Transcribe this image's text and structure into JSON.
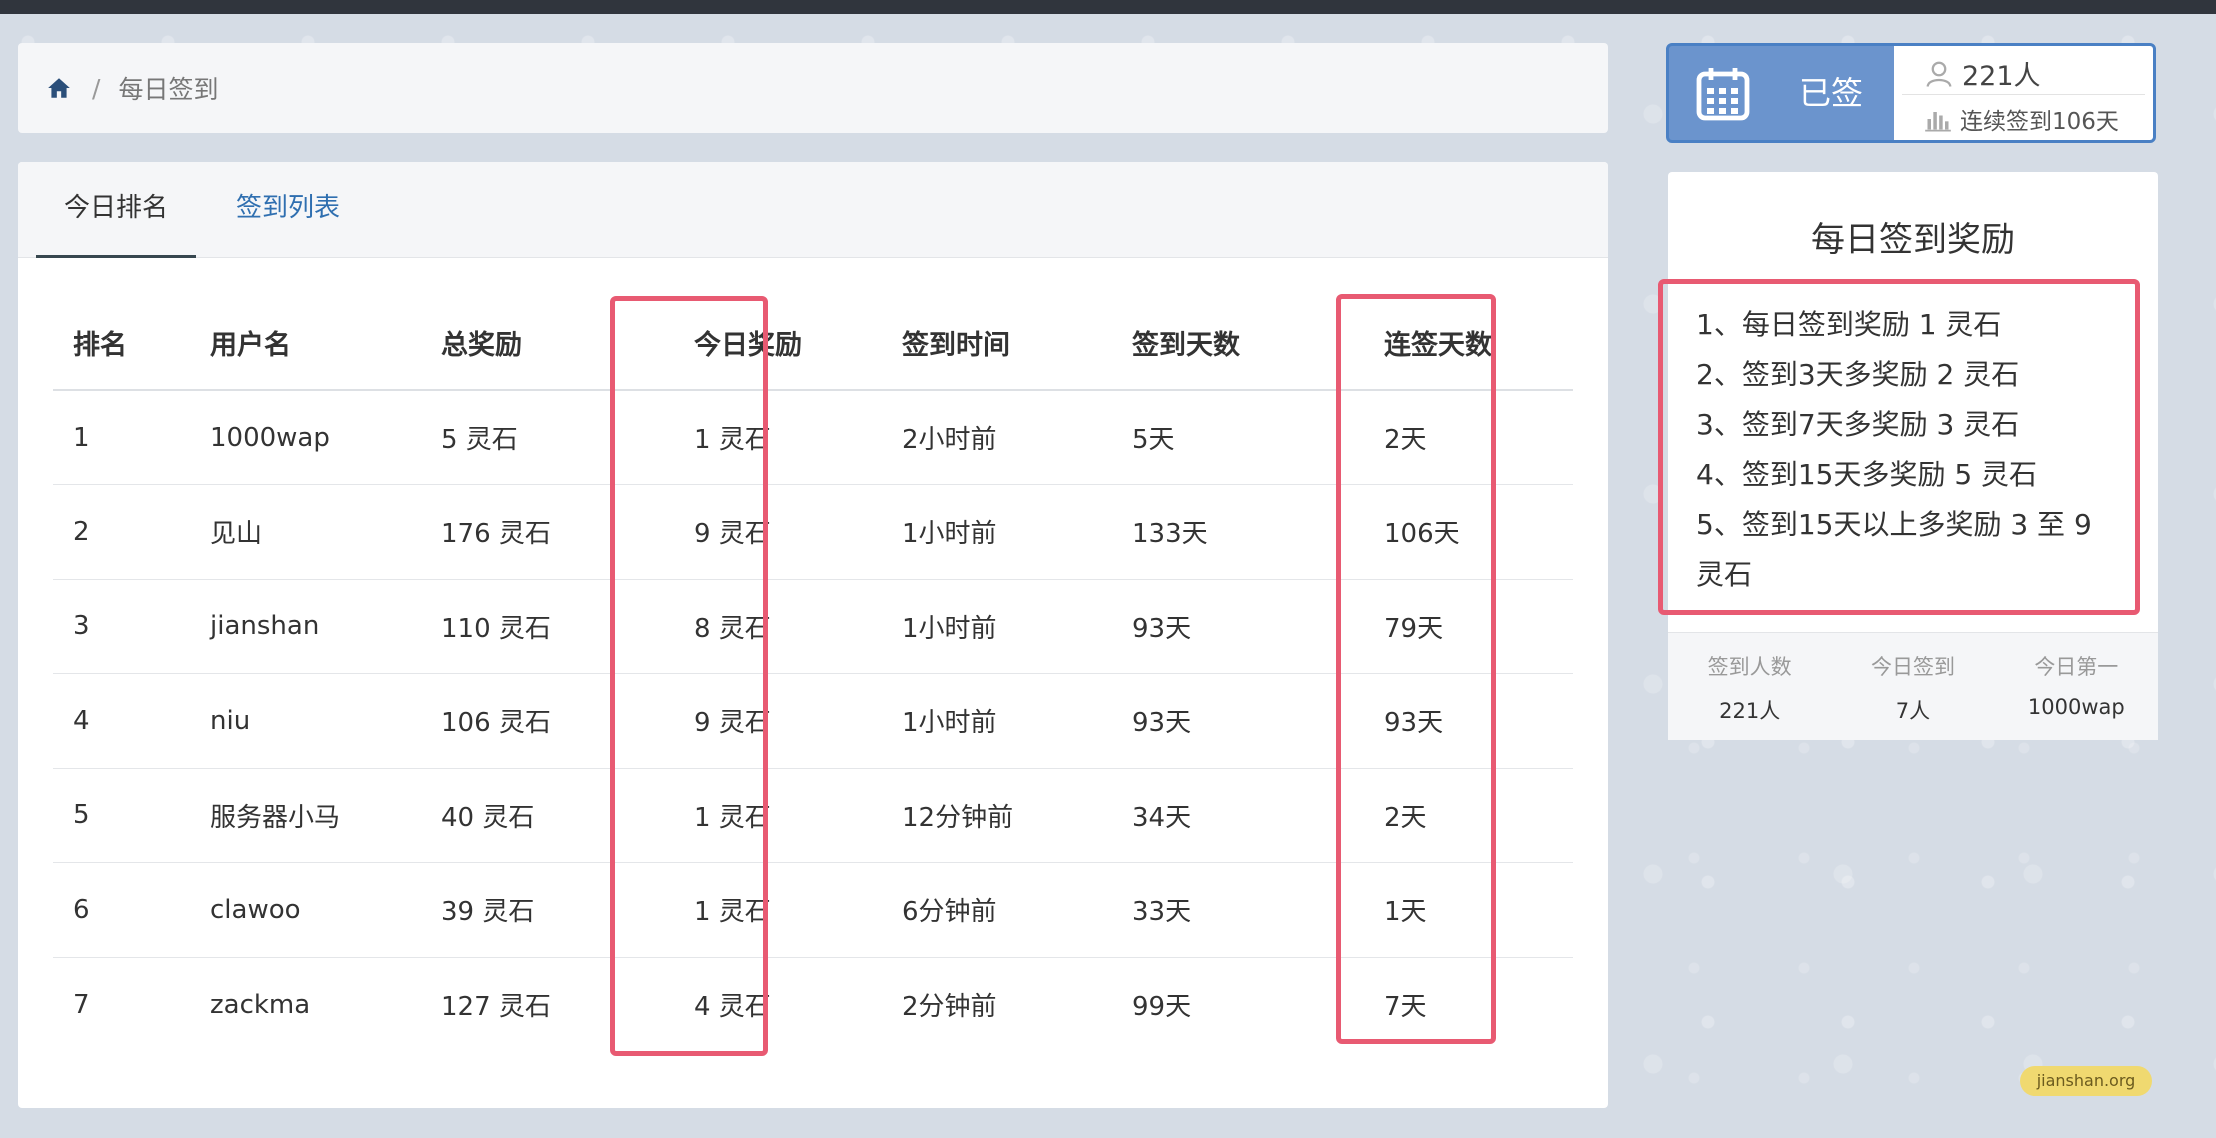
{
  "breadcrumb": {
    "current": "每日签到"
  },
  "tabs": [
    {
      "label": "今日排名",
      "active": true
    },
    {
      "label": "签到列表",
      "active": false
    }
  ],
  "table": {
    "headers": [
      "排名",
      "用户名",
      "总奖励",
      "今日奖励",
      "签到时间",
      "签到天数",
      "连签天数"
    ],
    "rows": [
      [
        "1",
        "1000wap",
        "5 灵石",
        "1 灵石",
        "2小时前",
        "5天",
        "2天"
      ],
      [
        "2",
        "见山",
        "176 灵石",
        "9 灵石",
        "1小时前",
        "133天",
        "106天"
      ],
      [
        "3",
        "jianshan",
        "110 灵石",
        "8 灵石",
        "1小时前",
        "93天",
        "79天"
      ],
      [
        "4",
        "niu",
        "106 灵石",
        "9 灵石",
        "1小时前",
        "93天",
        "93天"
      ],
      [
        "5",
        "服务器小马",
        "40 灵石",
        "1 灵石",
        "12分钟前",
        "34天",
        "2天"
      ],
      [
        "6",
        "clawoo",
        "39 灵石",
        "1 灵石",
        "6分钟前",
        "33天",
        "1天"
      ],
      [
        "7",
        "zackma",
        "127 灵石",
        "4 灵石",
        "2分钟前",
        "99天",
        "7天"
      ]
    ]
  },
  "signbox": {
    "status": "已签",
    "count": "221人",
    "streak": "连续签到106天"
  },
  "reward": {
    "title": "每日签到奖励",
    "rules": [
      "1、每日签到奖励 1 灵石",
      "2、签到3天多奖励 2 灵石",
      "3、签到7天多奖励 3 灵石",
      "4、签到15天多奖励 5 灵石",
      "5、签到15天以上多奖励 3 至 9 灵石"
    ],
    "stats": [
      {
        "label": "签到人数",
        "value": "221人"
      },
      {
        "label": "今日签到",
        "value": "7人"
      },
      {
        "label": "今日第一",
        "value": "1000wap"
      }
    ]
  },
  "watermark": "jianshan.org",
  "colors": {
    "accent": "#4a80c4",
    "highlight": "#e85a72"
  }
}
